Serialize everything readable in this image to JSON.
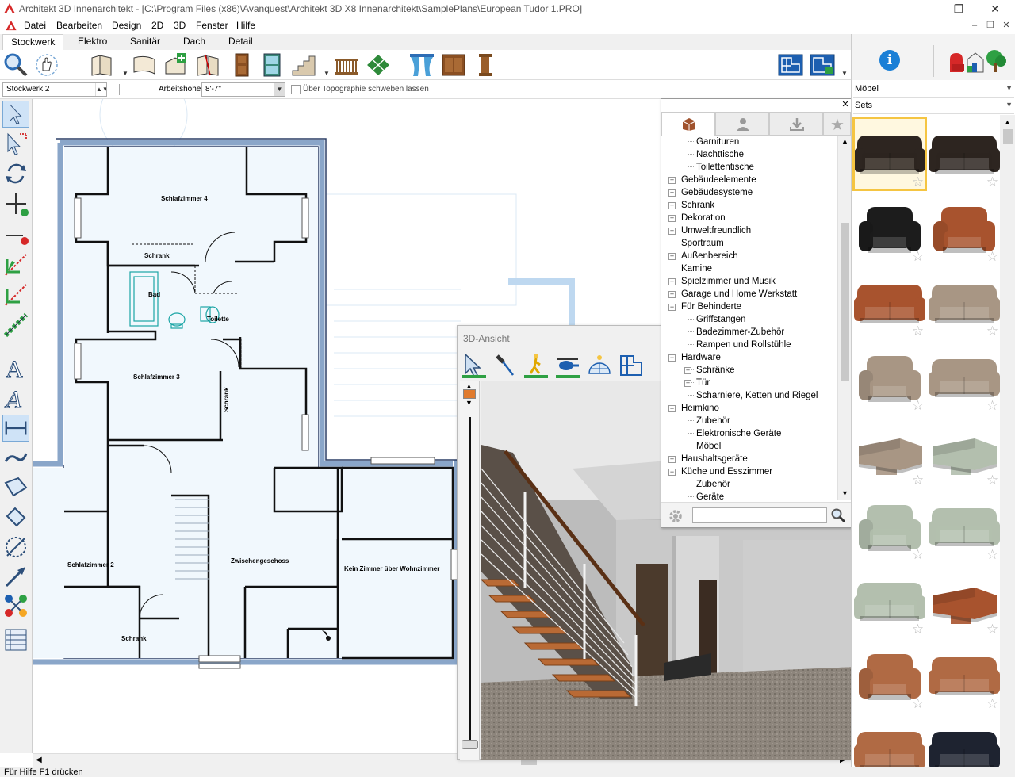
{
  "window": {
    "title": "Architekt 3D Innenarchitekt - [C:\\Program Files (x86)\\Avanquest\\Architekt 3D X8 Innenarchitekt\\SamplePlans\\European Tudor 1.PRO]"
  },
  "menu": {
    "items": [
      "Datei",
      "Bearbeiten",
      "Design",
      "2D",
      "3D",
      "Fenster",
      "Hilfe"
    ]
  },
  "ribbon": {
    "tabs": [
      "Stockwerk",
      "Elektro",
      "Sanitär",
      "Dach",
      "Detail"
    ],
    "active": "Stockwerk"
  },
  "options": {
    "floor_select": "Stockwerk 2",
    "height_label": "Arbeitshöhe:",
    "height_value": "8'-7\"",
    "topo_label": "Über Topographie schweben lassen"
  },
  "plan": {
    "rooms": [
      "Schlafzimmer 4",
      "Schrank",
      "Bad",
      "Toilette",
      "Schlafzimmer 3",
      "Schrank",
      "Schlafzimmer 2",
      "Zwischengeschoss",
      "Kein Zimmer über Wohnzimmer",
      "Schrank"
    ]
  },
  "view3d": {
    "title": "3D-Ansicht"
  },
  "library": {
    "tree": [
      {
        "label": "Garnituren",
        "level": 2,
        "expander": ""
      },
      {
        "label": "Nachttische",
        "level": 2,
        "expander": ""
      },
      {
        "label": "Toilettentische",
        "level": 2,
        "expander": ""
      },
      {
        "label": "Gebäudeelemente",
        "level": 1,
        "expander": "+"
      },
      {
        "label": "Gebäudesysteme",
        "level": 1,
        "expander": "+"
      },
      {
        "label": "Schrank",
        "level": 1,
        "expander": "+"
      },
      {
        "label": "Dekoration",
        "level": 1,
        "expander": "+"
      },
      {
        "label": "Umweltfreundlich",
        "level": 1,
        "expander": "+"
      },
      {
        "label": "Sportraum",
        "level": 1,
        "expander": ""
      },
      {
        "label": "Außenbereich",
        "level": 1,
        "expander": "+"
      },
      {
        "label": "Kamine",
        "level": 1,
        "expander": ""
      },
      {
        "label": "Spielzimmer und Musik",
        "level": 1,
        "expander": "+"
      },
      {
        "label": "Garage und Home Werkstatt",
        "level": 1,
        "expander": "+"
      },
      {
        "label": "Für Behinderte",
        "level": 1,
        "expander": "−"
      },
      {
        "label": "Griffstangen",
        "level": 2,
        "expander": ""
      },
      {
        "label": "Badezimmer-Zubehör",
        "level": 2,
        "expander": ""
      },
      {
        "label": "Rampen und Rollstühle",
        "level": 2,
        "expander": ""
      },
      {
        "label": "Hardware",
        "level": 1,
        "expander": "−"
      },
      {
        "label": "Schränke",
        "level": 2,
        "expander": "+"
      },
      {
        "label": "Tür",
        "level": 2,
        "expander": "+"
      },
      {
        "label": "Scharniere, Ketten und Riegel",
        "level": 2,
        "expander": ""
      },
      {
        "label": "Heimkino",
        "level": 1,
        "expander": "−"
      },
      {
        "label": "Zubehör",
        "level": 2,
        "expander": ""
      },
      {
        "label": "Elektronische Geräte",
        "level": 2,
        "expander": ""
      },
      {
        "label": "Möbel",
        "level": 2,
        "expander": ""
      },
      {
        "label": "Haushaltsgeräte",
        "level": 1,
        "expander": "+"
      },
      {
        "label": "Küche und Esszimmer",
        "level": 1,
        "expander": "−"
      },
      {
        "label": "Zubehör",
        "level": 2,
        "expander": ""
      },
      {
        "label": "Geräte",
        "level": 2,
        "expander": ""
      }
    ],
    "search_value": ""
  },
  "catalog": {
    "category": "Möbel",
    "subcategory": "Sets",
    "items": [
      {
        "icon": "sofa-icon",
        "color": "#2d2520"
      },
      {
        "icon": "sofa-icon",
        "color": "#2d2520"
      },
      {
        "icon": "armchair-icon",
        "color": "#1c1c1c"
      },
      {
        "icon": "armchair-icon",
        "color": "#a8532e"
      },
      {
        "icon": "sofa-icon",
        "color": "#a8532e"
      },
      {
        "icon": "sofa-icon",
        "color": "#a89684"
      },
      {
        "icon": "armchair-icon",
        "color": "#a89684"
      },
      {
        "icon": "sofa-icon",
        "color": "#a89684"
      },
      {
        "icon": "sectional-icon",
        "color": "#a89684"
      },
      {
        "icon": "sectional-icon",
        "color": "#b3bfae"
      },
      {
        "icon": "armchair-icon",
        "color": "#b3bfae"
      },
      {
        "icon": "sofa-icon",
        "color": "#b3bfae"
      },
      {
        "icon": "sofa-icon",
        "color": "#b3bfae"
      },
      {
        "icon": "sectional-icon",
        "color": "#a8532e"
      },
      {
        "icon": "armchair-icon",
        "color": "#b06a44"
      },
      {
        "icon": "sofa-icon",
        "color": "#b06a44"
      },
      {
        "icon": "sofa-icon",
        "color": "#b06a44"
      },
      {
        "icon": "sofa-icon",
        "color": "#1e2330"
      }
    ]
  },
  "status": {
    "text": "Für Hilfe F1 drücken"
  }
}
